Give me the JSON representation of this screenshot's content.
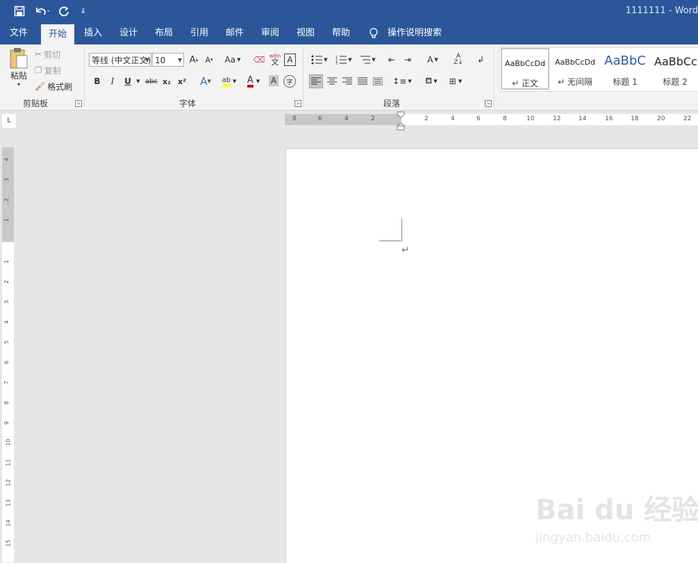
{
  "titlebar": {
    "doc_title": "1111111  -  Word",
    "bg_color": "#2b579a"
  },
  "tabs": {
    "items": [
      "文件",
      "开始",
      "插入",
      "设计",
      "布局",
      "引用",
      "邮件",
      "审阅",
      "视图",
      "帮助"
    ],
    "active": "开始",
    "tell_me": "操作说明搜索"
  },
  "clipboard": {
    "paste": "粘贴",
    "cut": "剪切",
    "copy": "复制",
    "format_painter": "格式刷",
    "group_label": "剪贴板"
  },
  "font": {
    "font_name": "等线 (中文正文)",
    "font_size": "10",
    "change_case": "Aa",
    "phonetic": "wén",
    "phonetic_sub": "文",
    "bold": "B",
    "italic": "I",
    "underline": "U",
    "strike": "abc",
    "subscript": "x₂",
    "superscript": "x²",
    "group_label": "字体"
  },
  "paragraph": {
    "group_label": "段落"
  },
  "styles": {
    "items": [
      {
        "sample": "AaBbCcDd",
        "name": "↵ 正文"
      },
      {
        "sample": "AaBbCcDd",
        "name": "↵ 无间隔"
      },
      {
        "sample": "AaBbC",
        "name": "标题 1"
      },
      {
        "sample": "AaBbCc",
        "name": "标题 2"
      }
    ]
  },
  "ruler": {
    "h_labels": [
      "8",
      "6",
      "4",
      "2",
      "2",
      "4",
      "6",
      "8",
      "10",
      "12",
      "14",
      "16",
      "18",
      "20",
      "22"
    ],
    "v_labels": [
      "4",
      "3",
      "2",
      "1",
      "1",
      "2",
      "3",
      "4",
      "5",
      "6",
      "7",
      "8",
      "9",
      "10",
      "11",
      "12",
      "13",
      "14",
      "15"
    ]
  },
  "document": {
    "para_mark": "↵"
  },
  "watermark": {
    "text": "Bai du 经验",
    "url": "jingyan.baidu.com"
  }
}
